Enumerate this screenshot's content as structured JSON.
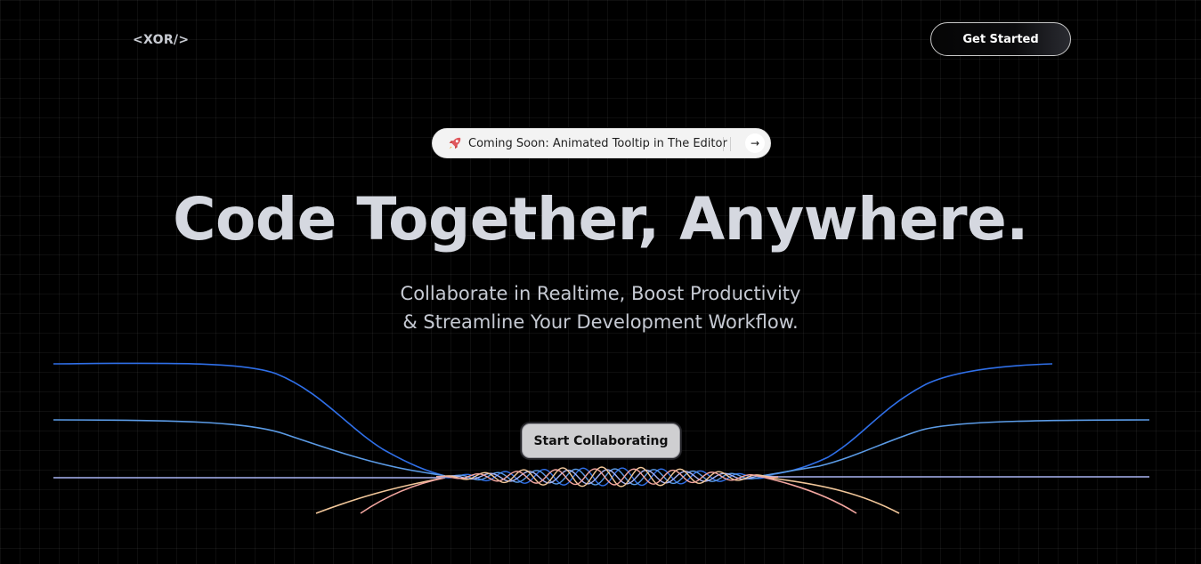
{
  "header": {
    "logo": "<XOR/>",
    "cta_label": "Get Started"
  },
  "announcement": {
    "icon": "rocket-icon",
    "text": "Coming Soon: Animated Tooltip in The Editor",
    "arrow": "→"
  },
  "hero": {
    "headline": "Code Together, Anywhere.",
    "subline_1": "Collaborate in Realtime, Boost Productivity",
    "subline_2": "& Streamline Your Development Workflow.",
    "cta_label": "Start Collaborating"
  },
  "colors": {
    "background": "#000000",
    "wave_blue": "#2f6fe8",
    "wave_light_blue": "#5b9be6",
    "wave_lavender": "#a9b4f2",
    "wave_peach": "#f2c79a",
    "wave_pink": "#f3a6a0"
  }
}
